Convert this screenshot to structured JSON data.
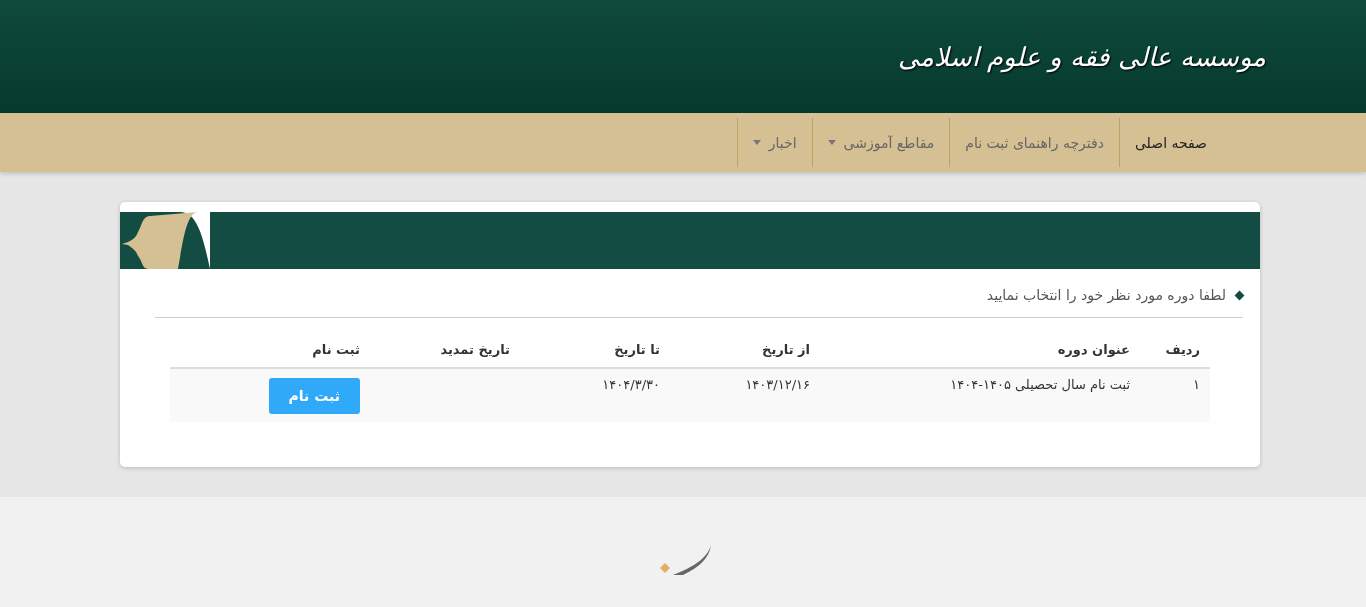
{
  "header": {
    "logo_text": "موسسه عالی فقه و علوم اسلامی"
  },
  "nav": [
    {
      "label": "صفحه اصلی",
      "selected": true,
      "dropdown": false
    },
    {
      "label": "دفترچه راهنمای ثبت نام",
      "selected": false,
      "dropdown": false
    },
    {
      "label": "مقاطع آموزشی",
      "selected": false,
      "dropdown": true
    },
    {
      "label": "اخبار",
      "selected": false,
      "dropdown": true
    }
  ],
  "card": {
    "instruction": "لطفا دوره مورد نظر خود را انتخاب نمایید",
    "table": {
      "columns": [
        "ردیف",
        "عنوان دوره",
        "از تاریخ",
        "تا تاریخ",
        "تاریخ تمدید",
        "ثبت نام"
      ],
      "rows": [
        {
          "index": "۱",
          "title": "ثبت نام سال تحصیلی ۱۴۰۵-۱۴۰۴",
          "from": "۱۴۰۳/۱۲/۱۶",
          "to": "۱۴۰۴/۳/۳۰",
          "extension": "",
          "action": "ثبت نام"
        }
      ]
    }
  }
}
